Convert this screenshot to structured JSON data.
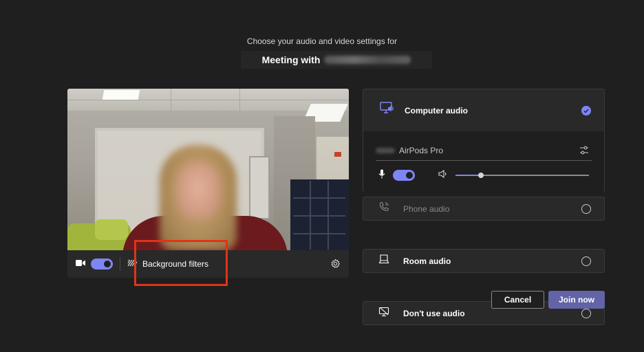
{
  "header": {
    "subtitle": "Choose your audio and video settings for",
    "meeting_prefix": "Meeting with"
  },
  "video": {
    "camera_toggle": "on",
    "background_filters_label": "Background filters"
  },
  "audio": {
    "options": [
      {
        "label": "Computer audio",
        "selected": true
      },
      {
        "label": "Phone audio",
        "selected": false,
        "disabled": true
      },
      {
        "label": "Room audio",
        "selected": false
      },
      {
        "label": "Don't use audio",
        "selected": false
      }
    ],
    "device_name": "AirPods Pro",
    "mic_toggle": "on",
    "volume_level": 0.19
  },
  "buttons": {
    "cancel_label": "Cancel",
    "join_label": "Join now"
  },
  "colors": {
    "accent": "#7f85f5",
    "primary_button": "#6264a7",
    "highlight": "#e0331a",
    "background": "#1f1f1f",
    "panel": "#292929"
  }
}
